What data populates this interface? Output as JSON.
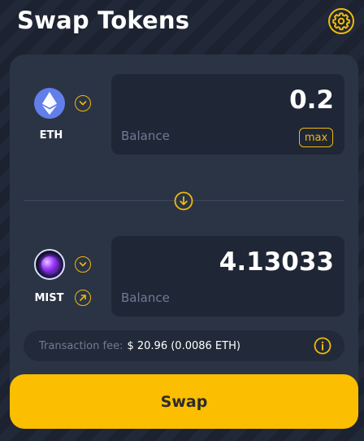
{
  "header": {
    "title": "Swap Tokens",
    "settings_icon": "gear-icon"
  },
  "from_token": {
    "symbol": "ETH",
    "logo_icon": "ethereum-logo-icon",
    "amount": "0.2",
    "balance_label": "Balance",
    "max_label": "max"
  },
  "to_token": {
    "symbol": "MIST",
    "logo_icon": "mist-logo-icon",
    "amount": "4.13033",
    "balance_label": "Balance",
    "link_icon": "arrow-up-right-icon"
  },
  "fee": {
    "label": "Transaction fee:",
    "value": "$ 20.96 (0.0086 ETH)",
    "info_icon": "info-icon"
  },
  "swap_button": {
    "label": "Swap"
  },
  "colors": {
    "accent": "#f0b90b",
    "swap_button": "#fcbe00",
    "card_background": "#2b3445",
    "input_background": "#1f2636"
  }
}
